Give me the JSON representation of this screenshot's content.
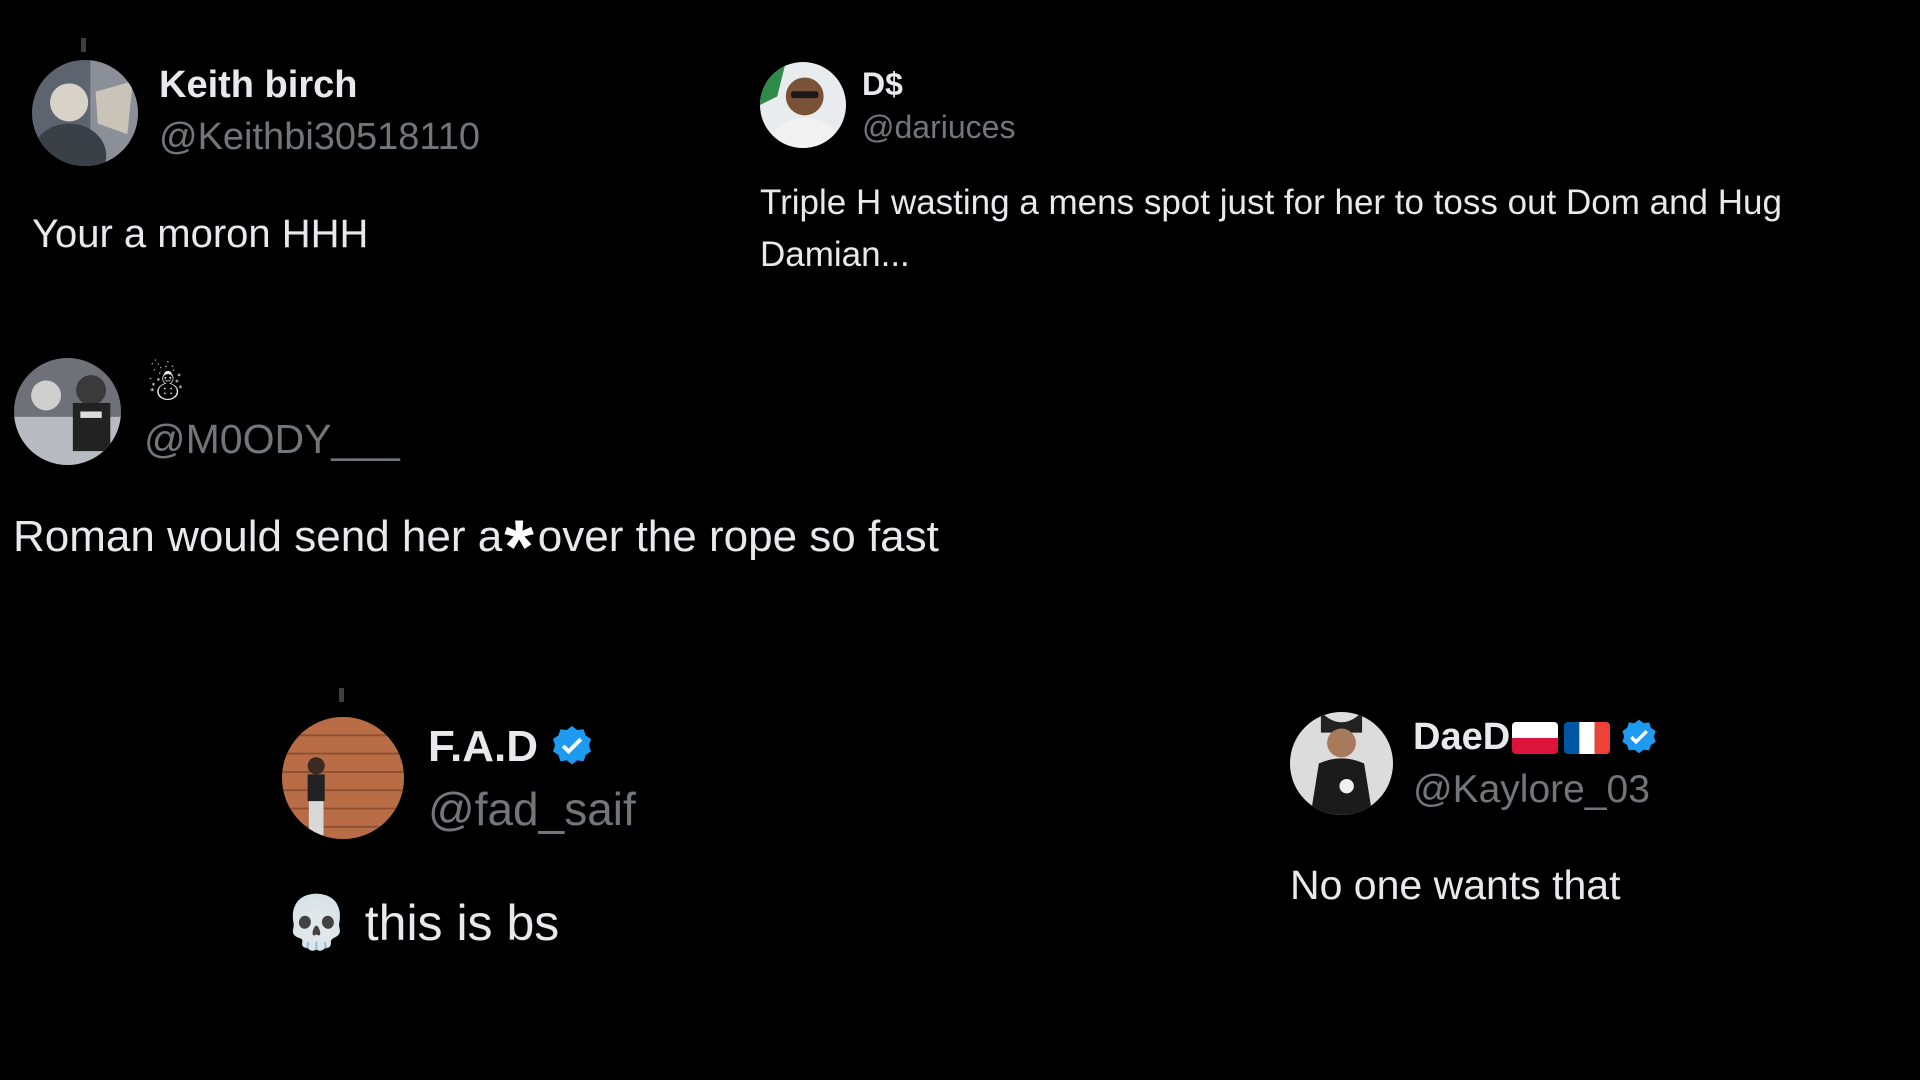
{
  "tweets": [
    {
      "name": "Keith birch",
      "handle": "@Keithbi30518110",
      "text": "Your a moron HHH",
      "avatar_icon": "user-photo-icon"
    },
    {
      "name": "D$",
      "handle": "@dariuces",
      "text_line1": "Triple H wasting a mens spot just for her to toss out Dom and Hug",
      "text_line2": "Damian...",
      "avatar_icon": "user-photo-icon"
    },
    {
      "name": "☃",
      "handle": "@M0ODY___",
      "text_before": "Roman would send her a",
      "censor": "*",
      "text_after": "over the rope so fast",
      "avatar_icon": "user-photo-icon"
    },
    {
      "name": "F.A.D",
      "handle": "@fad_saif",
      "text": "this is bs",
      "emoji": "💀",
      "verified": true,
      "avatar_icon": "user-photo-icon"
    },
    {
      "name": "DaeD",
      "handle": "@Kaylore_03",
      "text": "No one wants that",
      "verified": true,
      "flags": [
        "poland-flag-icon",
        "france-flag-icon"
      ],
      "avatar_icon": "user-photo-icon"
    }
  ],
  "colors": {
    "background": "#000000",
    "text": "#e7e9ea",
    "handle": "#71767b",
    "verified": "#1d9bf0"
  }
}
